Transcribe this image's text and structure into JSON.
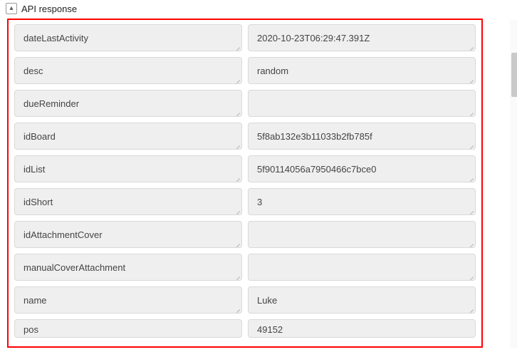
{
  "header": {
    "title": "API response",
    "collapse_glyph": "▴"
  },
  "fields": [
    {
      "key": "dateLastActivity",
      "value": "2020-10-23T06:29:47.391Z"
    },
    {
      "key": "desc",
      "value": "random"
    },
    {
      "key": "dueReminder",
      "value": ""
    },
    {
      "key": "idBoard",
      "value": "5f8ab132e3b11033b2fb785f"
    },
    {
      "key": "idList",
      "value": "5f90114056a7950466c7bce0"
    },
    {
      "key": "idShort",
      "value": "3"
    },
    {
      "key": "idAttachmentCover",
      "value": ""
    },
    {
      "key": "manualCoverAttachment",
      "value": ""
    },
    {
      "key": "name",
      "value": "Luke"
    },
    {
      "key": "pos",
      "value": "49152"
    }
  ]
}
